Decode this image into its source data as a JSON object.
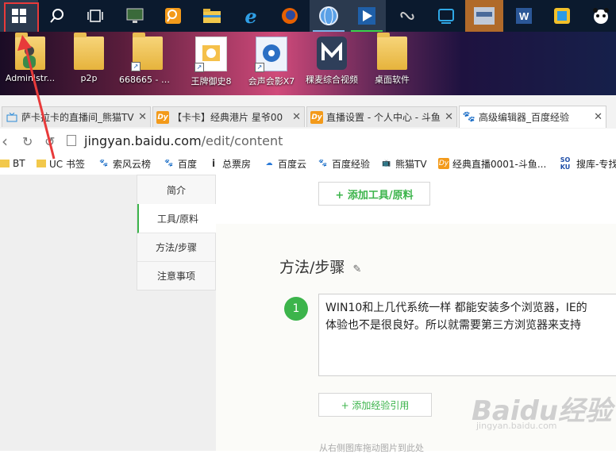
{
  "taskbar": {
    "icons": [
      "windows-start",
      "search",
      "task-view",
      "monitor-app",
      "search-magnifier-app",
      "file-explorer",
      "internet-explorer",
      "firefox",
      "browser-globe",
      "video-player",
      "fan-app",
      "tablet-app",
      "game-app",
      "word",
      "yellow-app",
      "panda-app"
    ]
  },
  "desktop": {
    "icons": [
      {
        "label": "Administr..."
      },
      {
        "label": "p2p"
      },
      {
        "label": "668665 - 快..."
      },
      {
        "label": "王牌御史8"
      },
      {
        "label": "会声会影X7"
      },
      {
        "label": "稞麦综合视频"
      },
      {
        "label": "桌面软件"
      }
    ]
  },
  "tabs": [
    {
      "title": "萨卡拉卡的直播间_熊猫TV"
    },
    {
      "title": "【卡卡】经典港片 星爷00"
    },
    {
      "title": "直播设置 - 个人中心 - 斗鱼"
    },
    {
      "title": "高级编辑器_百度经验"
    }
  ],
  "address": {
    "url_host": "jingyan.baidu.com",
    "url_path": "/edit/content"
  },
  "bookmarks": [
    "BT",
    "UC 书签",
    "索风云榜",
    "百度",
    "总票房",
    "百度云",
    "百度经验",
    "熊猫TV",
    "经典直播0001-斗鱼...",
    "搜库-专找"
  ],
  "sidenav": [
    "简介",
    "工具/原料",
    "方法/步骤",
    "注意事项"
  ],
  "editor": {
    "add_tool_label": "+ 添加工具/原料",
    "section_title": "方法/步骤",
    "step_number": "1",
    "step_text_line1": "WIN10和上几代系统一样 都能安装多个浏览器，IE的",
    "step_text_line2": "体验也不是很良好。所以就需要第三方浏览器来支持",
    "add_ref_label": "+ 添加经验引用",
    "hint": "从右侧图库拖动图片到此处"
  },
  "watermark": {
    "logo": "Baidu经验",
    "url": "jingyan.baidu.com"
  }
}
